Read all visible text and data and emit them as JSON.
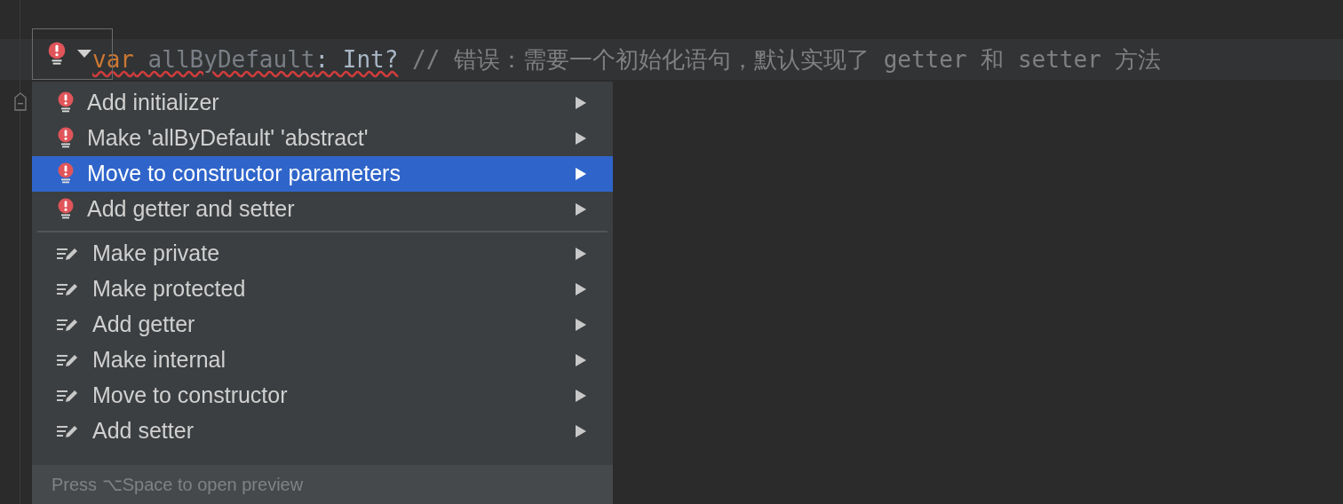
{
  "editor": {
    "code_line": [
      {
        "kind": "keyword",
        "text": "var",
        "error": true
      },
      {
        "kind": "unused",
        "text": " allByDefault",
        "error": true
      },
      {
        "kind": "plain",
        "text": ": Int?",
        "error": true
      },
      {
        "kind": "comment",
        "text": " // 错误：需要一个初始化语句，默认实现了 getter 和 setter 方法",
        "error": false
      }
    ]
  },
  "popup": {
    "items": [
      {
        "kind": "error",
        "label": "Add initializer",
        "selected": false
      },
      {
        "kind": "error",
        "label": "Make 'allByDefault' 'abstract'",
        "selected": false
      },
      {
        "kind": "error",
        "label": "Move to constructor parameters",
        "selected": true
      },
      {
        "kind": "error",
        "label": "Add getter and setter",
        "selected": false
      },
      {
        "kind": "intention",
        "label": "Make private",
        "selected": false
      },
      {
        "kind": "intention",
        "label": "Make protected",
        "selected": false
      },
      {
        "kind": "intention",
        "label": "Add getter",
        "selected": false
      },
      {
        "kind": "intention",
        "label": "Make internal",
        "selected": false
      },
      {
        "kind": "intention",
        "label": "Move to constructor",
        "selected": false
      },
      {
        "kind": "intention",
        "label": "Add setter",
        "selected": false
      }
    ],
    "footer": "Press ⌥Space to open preview"
  }
}
